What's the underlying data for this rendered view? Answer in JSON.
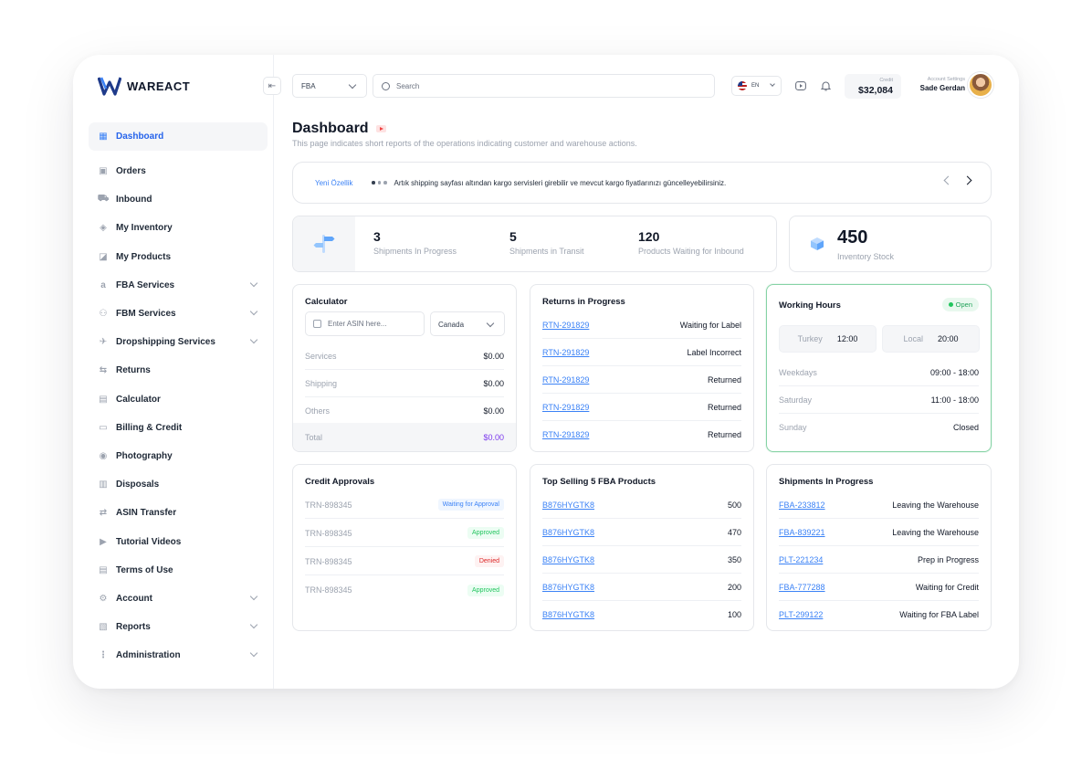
{
  "brand": {
    "name": "WAREACT"
  },
  "nav": {
    "items": [
      {
        "label": "Dashboard",
        "icon": "grid-icon",
        "active": true
      },
      {
        "label": "Orders",
        "icon": "box-icon"
      },
      {
        "label": "Inbound",
        "icon": "truck-icon"
      },
      {
        "label": "My Inventory",
        "icon": "cube-icon"
      },
      {
        "label": "My Products",
        "icon": "tag-icon"
      },
      {
        "label": "FBA Services",
        "icon": "amazon-icon",
        "expandable": true
      },
      {
        "label": "FBM Services",
        "icon": "users-icon",
        "expandable": true
      },
      {
        "label": "Dropshipping Services",
        "icon": "plane-icon",
        "expandable": true
      },
      {
        "label": "Returns",
        "icon": "return-icon"
      },
      {
        "label": "Calculator",
        "icon": "calculator-icon"
      },
      {
        "label": "Billing & Credit",
        "icon": "card-icon"
      },
      {
        "label": "Photography",
        "icon": "camera-icon"
      },
      {
        "label": "Disposals",
        "icon": "trash-icon"
      },
      {
        "label": "ASIN Transfer",
        "icon": "transfer-icon"
      },
      {
        "label": "Tutorial Videos",
        "icon": "play-icon"
      },
      {
        "label": "Terms of Use",
        "icon": "document-icon"
      },
      {
        "label": "Account",
        "icon": "gear-icon",
        "expandable": true
      },
      {
        "label": "Reports",
        "icon": "report-icon",
        "expandable": true
      },
      {
        "label": "Administration",
        "icon": "hierarchy-icon",
        "expandable": true
      }
    ]
  },
  "topbar": {
    "service_select": "FBA",
    "search_placeholder": "Search",
    "language": "EN",
    "credit_label": "Credit",
    "credit_value": "$32,084",
    "account_label": "Account Settings",
    "account_name": "Sade Gerdan"
  },
  "header": {
    "title": "Dashboard",
    "subtitle": "This page indicates short reports of the operations indicating customer and warehouse actions."
  },
  "ticker": {
    "tag": "Yeni Özellik",
    "message": "Artık shipping sayfası altından kargo servisleri girebilir ve mevcut kargo fiyatlarınızı güncelleyebilirsiniz."
  },
  "stats": [
    {
      "value": "3",
      "label": "Shipments In Progress"
    },
    {
      "value": "5",
      "label": "Shipments in Transit"
    },
    {
      "value": "120",
      "label": "Products Waiting for Inbound"
    }
  ],
  "inventory": {
    "value": "450",
    "label": "Inventory Stock"
  },
  "calculator": {
    "title": "Calculator",
    "asin_placeholder": "Enter ASIN here...",
    "country": "Canada",
    "rows": [
      {
        "label": "Services",
        "value": "$0.00"
      },
      {
        "label": "Shipping",
        "value": "$0.00"
      },
      {
        "label": "Others",
        "value": "$0.00"
      }
    ],
    "total_label": "Total",
    "total_value": "$0.00"
  },
  "returns": {
    "title": "Returns in Progress",
    "rows": [
      {
        "id": "RTN-291829",
        "status": "Waiting for Label"
      },
      {
        "id": "RTN-291829",
        "status": "Label Incorrect"
      },
      {
        "id": "RTN-291829",
        "status": "Returned"
      },
      {
        "id": "RTN-291829",
        "status": "Returned"
      },
      {
        "id": "RTN-291829",
        "status": "Returned"
      }
    ]
  },
  "working_hours": {
    "title": "Working Hours",
    "status": "Open",
    "zones": [
      {
        "label": "Turkey",
        "time": "12:00"
      },
      {
        "label": "Local",
        "time": "20:00"
      }
    ],
    "rows": [
      {
        "day": "Weekdays",
        "hours": "09:00 - 18:00"
      },
      {
        "day": "Saturday",
        "hours": "11:00 - 18:00"
      },
      {
        "day": "Sunday",
        "hours": "Closed"
      }
    ]
  },
  "credit_approvals": {
    "title": "Credit Approvals",
    "rows": [
      {
        "id": "TRN-898345",
        "status": "Waiting for Approval",
        "kind": "wait"
      },
      {
        "id": "TRN-898345",
        "status": "Approved",
        "kind": "ok"
      },
      {
        "id": "TRN-898345",
        "status": "Denied",
        "kind": "no"
      },
      {
        "id": "TRN-898345",
        "status": "Approved",
        "kind": "ok"
      }
    ]
  },
  "top_selling": {
    "title": "Top Selling 5 FBA Products",
    "rows": [
      {
        "asin": "B876HYGTK8",
        "qty": "500"
      },
      {
        "asin": "B876HYGTK8",
        "qty": "470"
      },
      {
        "asin": "B876HYGTK8",
        "qty": "350"
      },
      {
        "asin": "B876HYGTK8",
        "qty": "200"
      },
      {
        "asin": "B876HYGTK8",
        "qty": "100"
      }
    ]
  },
  "shipments": {
    "title": "Shipments In Progress",
    "rows": [
      {
        "id": "FBA-233812",
        "status": "Leaving the Warehouse"
      },
      {
        "id": "FBA-839221",
        "status": "Leaving the Warehouse"
      },
      {
        "id": "PLT-221234",
        "status": "Prep in Progress"
      },
      {
        "id": "FBA-777288",
        "status": "Waiting for Credit"
      },
      {
        "id": "PLT-299122",
        "status": "Waiting for FBA Label"
      }
    ]
  }
}
